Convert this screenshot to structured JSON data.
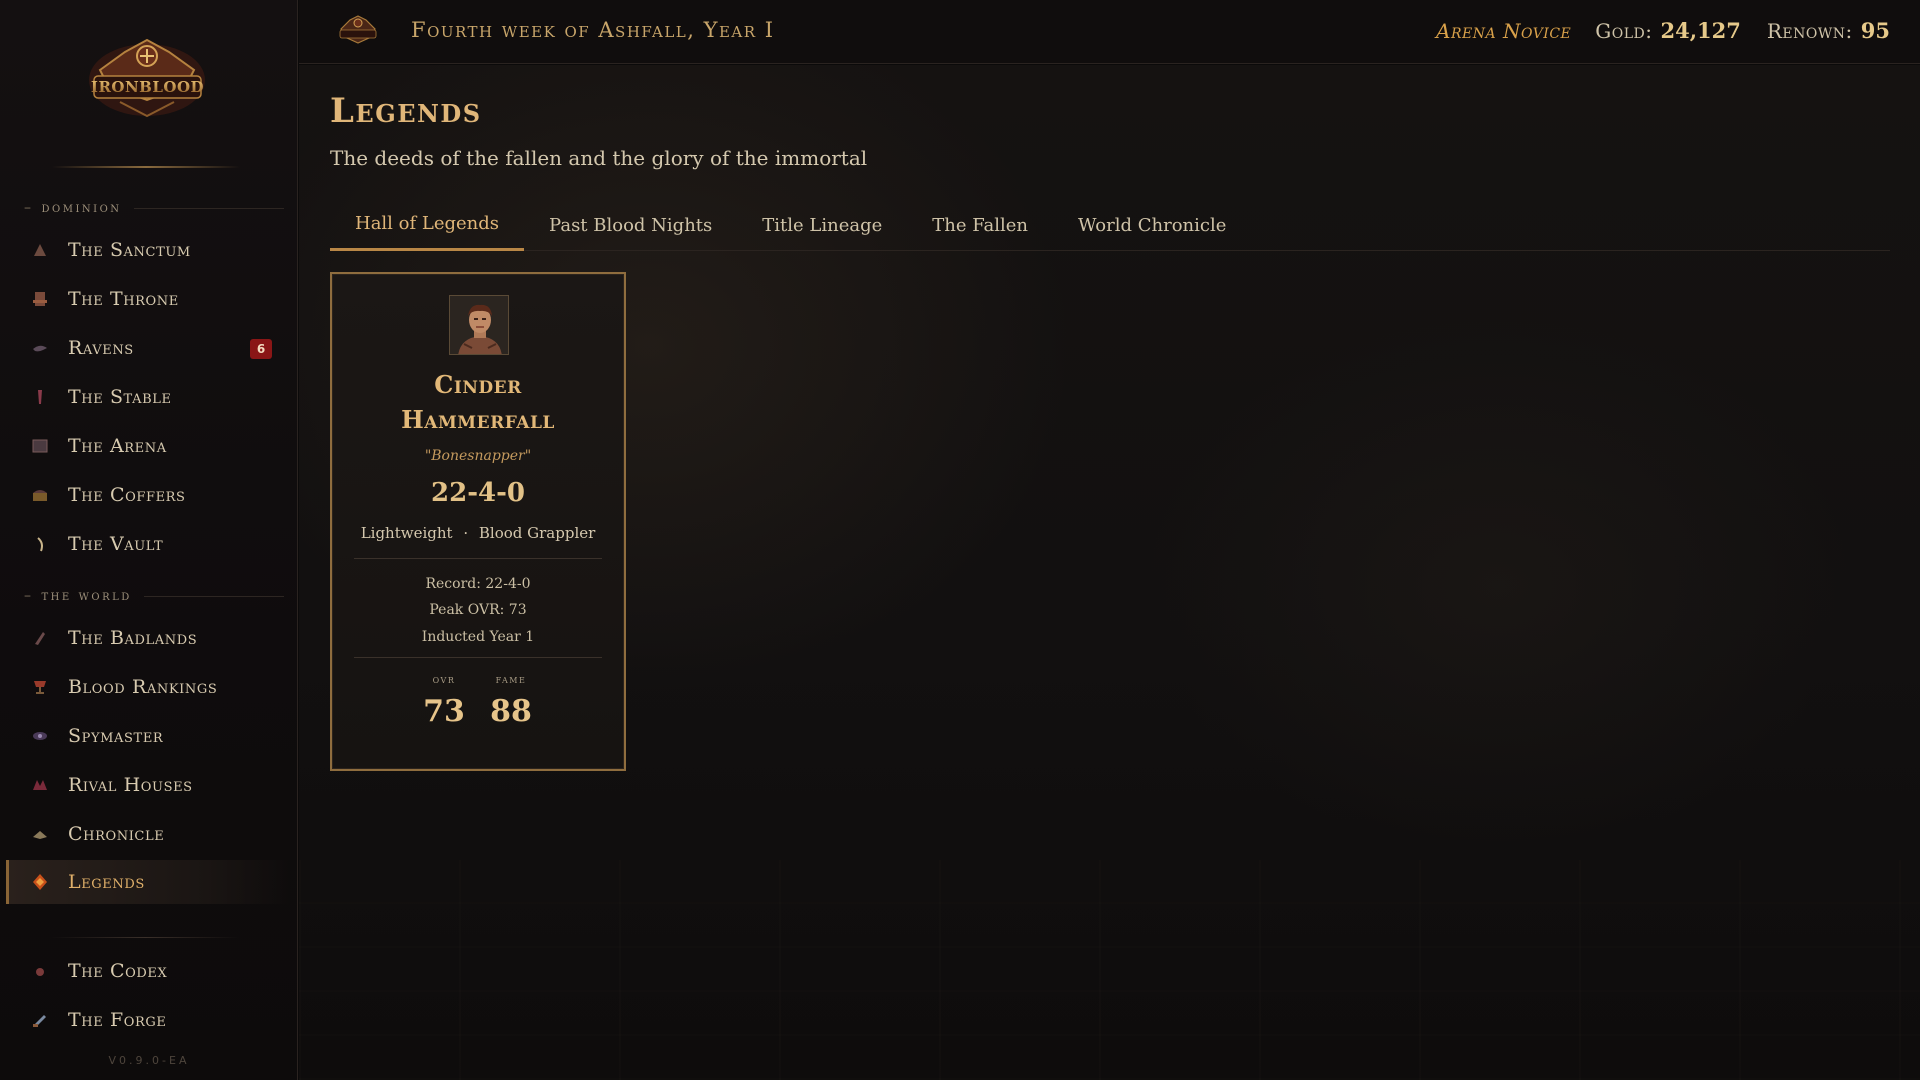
{
  "app": {
    "name": "Ironblood",
    "version": "V0.9.0-EA"
  },
  "sidebar": {
    "sections": [
      {
        "label": "dominion"
      },
      {
        "label": "the world"
      }
    ],
    "items": [
      {
        "label": "The Sanctum",
        "icon": "sanctum-icon"
      },
      {
        "label": "The Throne",
        "icon": "throne-icon"
      },
      {
        "label": "Ravens",
        "icon": "raven-icon",
        "badge": "6"
      },
      {
        "label": "The Stable",
        "icon": "stable-icon"
      },
      {
        "label": "The Arena",
        "icon": "arena-icon"
      },
      {
        "label": "The Coffers",
        "icon": "coffers-icon"
      },
      {
        "label": "The Vault",
        "icon": "vault-icon"
      },
      {
        "label": "The Badlands",
        "icon": "badlands-icon"
      },
      {
        "label": "Blood Rankings",
        "icon": "rankings-icon"
      },
      {
        "label": "Spymaster",
        "icon": "spymaster-icon"
      },
      {
        "label": "Rival Houses",
        "icon": "rival-houses-icon"
      },
      {
        "label": "Chronicle",
        "icon": "chronicle-icon"
      },
      {
        "label": "Legends",
        "icon": "legends-icon",
        "active": true
      },
      {
        "label": "The Codex",
        "icon": "codex-icon"
      },
      {
        "label": "The Forge",
        "icon": "forge-icon"
      }
    ]
  },
  "topbar": {
    "date": "Fourth week of Ashfall, Year I",
    "rank": "Arena Novice",
    "gold_label": "Gold:",
    "gold_value": "24,127",
    "renown_label": "Renown:",
    "renown_value": "95"
  },
  "page": {
    "title": "Legends",
    "subtitle": "The deeds of the fallen and the glory of the immortal",
    "tabs": [
      {
        "label": "Hall of Legends",
        "active": true
      },
      {
        "label": "Past Blood Nights"
      },
      {
        "label": "Title Lineage"
      },
      {
        "label": "The Fallen"
      },
      {
        "label": "World Chronicle"
      }
    ]
  },
  "legend_card": {
    "name_line1": "Cinder",
    "name_line2": "Hammerfall",
    "nickname": "\"Bonesnapper\"",
    "record_display": "22-4-0",
    "weight_class": "Lightweight",
    "separator": "·",
    "style": "Blood Grappler",
    "record_line": "Record: 22-4-0",
    "peak_line": "Peak OVR: 73",
    "inducted_line": "Inducted Year 1",
    "ovr_label": "ovr",
    "ovr_value": "73",
    "fame_label": "fame",
    "fame_value": "88"
  },
  "colors": {
    "accent_gold": "#e0b679",
    "badge_red": "#8a1616",
    "card_border": "#8f6d3e"
  }
}
